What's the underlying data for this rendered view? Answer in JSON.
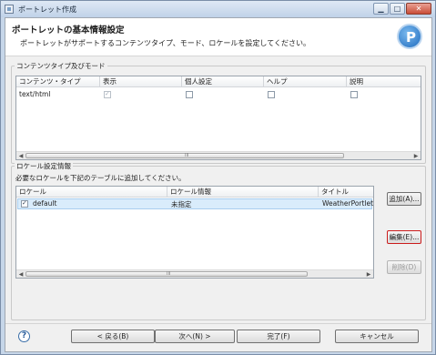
{
  "window": {
    "title": "ポートレット作成",
    "controls": {
      "minimize": "▁",
      "maximize": "□",
      "close": "✕"
    }
  },
  "header": {
    "title": "ポートレットの基本情報設定",
    "subtitle": "ポートレットがサポートするコンテンツタイプ、モード、ロケールを設定してください。",
    "logo_letter": "P",
    "logo_icon": "portlet-logo-icon"
  },
  "content_group": {
    "label": "コンテンツタイプ及びモード",
    "columns": [
      "コンテンツ・タイプ",
      "表示",
      "個人設定",
      "ヘルプ",
      "説明"
    ],
    "rows": [
      {
        "type": "text/html",
        "view": true,
        "edit": false,
        "help": false,
        "desc": false
      }
    ],
    "scroll_grip": "III"
  },
  "locale_group": {
    "label": "ロケール設定情報",
    "instruction": "必要なロケールを下記のテーブルに追加してください。",
    "columns": [
      "ロケール",
      "ロケール情報",
      "タイトル"
    ],
    "rows": [
      {
        "checked": true,
        "locale": "default",
        "info": "未指定",
        "title": "WeatherPortlet"
      }
    ],
    "scroll_grip": "III",
    "buttons": {
      "add": "追加(A)...",
      "edit": "編集(E)...",
      "delete": "削除(D)"
    }
  },
  "footer": {
    "help_icon": "?",
    "back": "< 戻る(B)",
    "next": "次へ(N) >",
    "finish": "完了(F)",
    "cancel": "キャンセル"
  },
  "colors": {
    "accent": "#1f6cbf",
    "focus_border": "#cc1c1c",
    "selection": "#d9ecfb"
  }
}
